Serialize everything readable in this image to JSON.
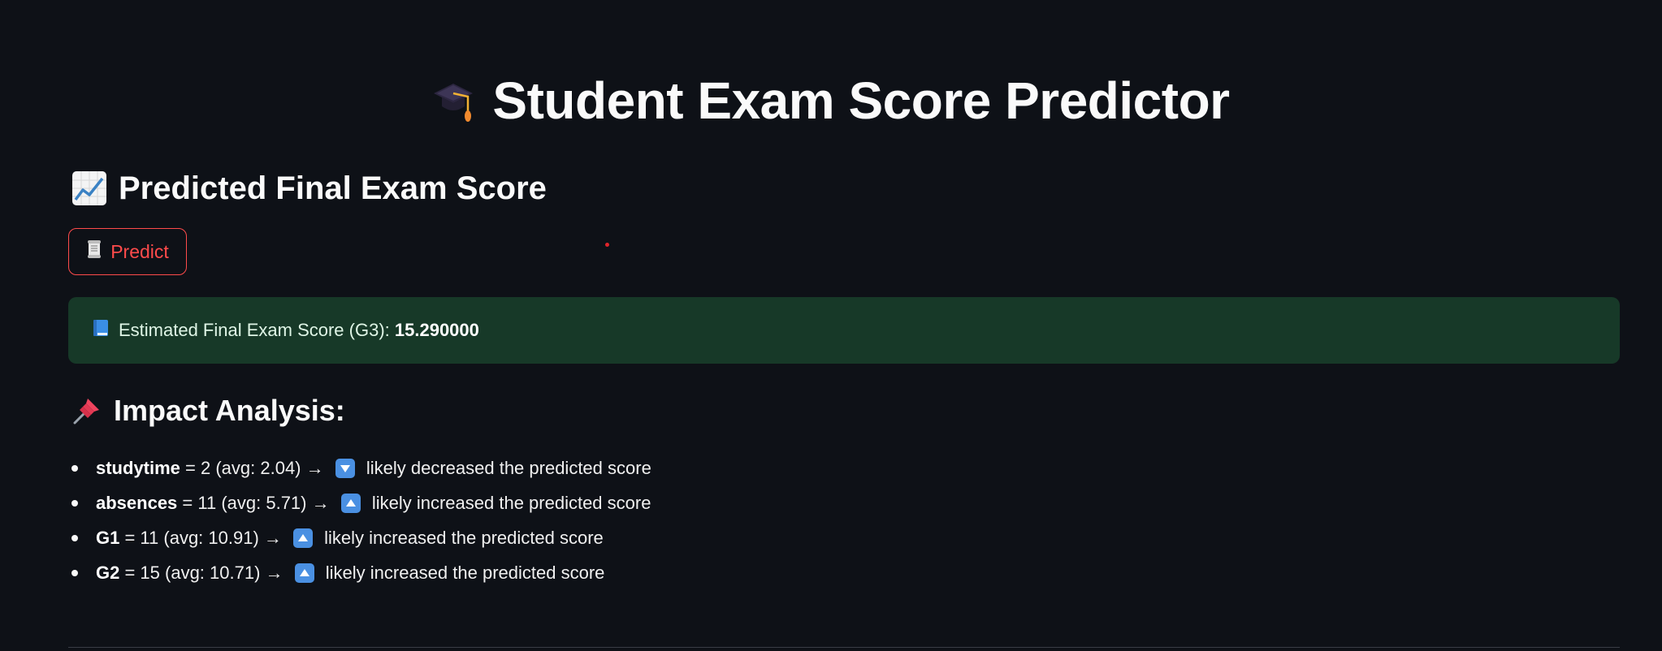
{
  "header": {
    "icon": "graduation-cap-icon",
    "title": "Student Exam Score Predictor"
  },
  "prediction_section": {
    "icon": "chart-increasing-icon",
    "heading": "Predicted Final Exam Score"
  },
  "predict_button": {
    "icon": "scroll-icon",
    "label": "Predict",
    "color": "#ff4b4b"
  },
  "result": {
    "icon": "blue-book-icon",
    "label": "Estimated Final Exam Score (G3): ",
    "value": "15.290000",
    "background": "#173928"
  },
  "impact_section": {
    "icon": "pushpin-icon",
    "heading": "Impact Analysis:",
    "items": [
      {
        "feature": "studytime",
        "detail": " = 2 (avg: 2.04) → ",
        "direction": "down",
        "icon": "down-arrow-icon",
        "effect": " likely decreased the predicted score"
      },
      {
        "feature": "absences",
        "detail": " = 11 (avg: 5.71) → ",
        "direction": "up",
        "icon": "up-arrow-icon",
        "effect": " likely increased the predicted score"
      },
      {
        "feature": "G1",
        "detail": " = 11 (avg: 10.91) → ",
        "direction": "up",
        "icon": "up-arrow-icon",
        "effect": " likely increased the predicted score"
      },
      {
        "feature": "G2",
        "detail": " = 15 (avg: 10.71) → ",
        "direction": "up",
        "icon": "up-arrow-icon",
        "effect": " likely increased the predicted score"
      }
    ]
  },
  "colors": {
    "background": "#0e1117",
    "accent": "#ff4b4b",
    "arrow": "#4a90e2"
  }
}
